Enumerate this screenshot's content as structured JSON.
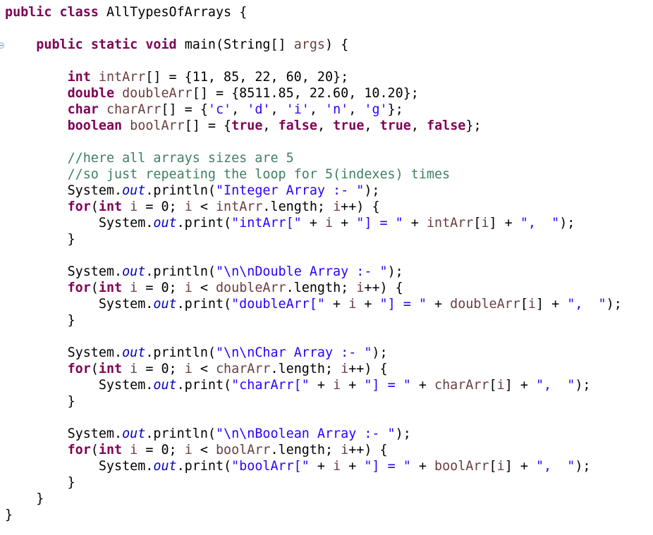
{
  "editor": {
    "lines": [
      [
        {
          "t": "public",
          "c": "kw"
        },
        {
          "t": " "
        },
        {
          "t": "class",
          "c": "kw"
        },
        {
          "t": " AllTypesOfArrays {"
        }
      ],
      [
        {
          "t": ""
        }
      ],
      [
        {
          "t": "    "
        },
        {
          "t": "public",
          "c": "kw"
        },
        {
          "t": " "
        },
        {
          "t": "static",
          "c": "kw"
        },
        {
          "t": " "
        },
        {
          "t": "void",
          "c": "kw"
        },
        {
          "t": " main(String[] "
        },
        {
          "t": "args",
          "c": "var"
        },
        {
          "t": ") {"
        }
      ],
      [
        {
          "t": ""
        }
      ],
      [
        {
          "t": "        "
        },
        {
          "t": "int",
          "c": "kw"
        },
        {
          "t": " "
        },
        {
          "t": "intArr",
          "c": "var"
        },
        {
          "t": "[] = {11, 85, 22, 60, 20};"
        }
      ],
      [
        {
          "t": "        "
        },
        {
          "t": "double",
          "c": "kw"
        },
        {
          "t": " "
        },
        {
          "t": "doubleArr",
          "c": "var"
        },
        {
          "t": "[] = {8511.85, 22.60, 10.20};"
        }
      ],
      [
        {
          "t": "        "
        },
        {
          "t": "char",
          "c": "kw"
        },
        {
          "t": " "
        },
        {
          "t": "charArr",
          "c": "var"
        },
        {
          "t": "[] = {"
        },
        {
          "t": "'c'",
          "c": "str"
        },
        {
          "t": ", "
        },
        {
          "t": "'d'",
          "c": "str"
        },
        {
          "t": ", "
        },
        {
          "t": "'i'",
          "c": "str"
        },
        {
          "t": ", "
        },
        {
          "t": "'n'",
          "c": "str"
        },
        {
          "t": ", "
        },
        {
          "t": "'g'",
          "c": "str"
        },
        {
          "t": "};"
        }
      ],
      [
        {
          "t": "        "
        },
        {
          "t": "boolean",
          "c": "kw"
        },
        {
          "t": " "
        },
        {
          "t": "boolArr",
          "c": "var"
        },
        {
          "t": "[] = {"
        },
        {
          "t": "true",
          "c": "kw"
        },
        {
          "t": ", "
        },
        {
          "t": "false",
          "c": "kw"
        },
        {
          "t": ", "
        },
        {
          "t": "true",
          "c": "kw"
        },
        {
          "t": ", "
        },
        {
          "t": "true",
          "c": "kw"
        },
        {
          "t": ", "
        },
        {
          "t": "false",
          "c": "kw"
        },
        {
          "t": "};"
        }
      ],
      [
        {
          "t": ""
        }
      ],
      [
        {
          "t": "        "
        },
        {
          "t": "//here all arrays sizes are 5",
          "c": "cmt"
        }
      ],
      [
        {
          "t": "        "
        },
        {
          "t": "//so just repeating the loop for 5(indexes) times",
          "c": "cmt"
        }
      ],
      [
        {
          "t": "        System."
        },
        {
          "t": "out",
          "c": "fld"
        },
        {
          "t": ".println("
        },
        {
          "t": "\"Integer Array :- \"",
          "c": "str"
        },
        {
          "t": ");"
        }
      ],
      [
        {
          "t": "        "
        },
        {
          "t": "for",
          "c": "kw"
        },
        {
          "t": "("
        },
        {
          "t": "int",
          "c": "kw"
        },
        {
          "t": " "
        },
        {
          "t": "i",
          "c": "var"
        },
        {
          "t": " = 0; "
        },
        {
          "t": "i",
          "c": "var"
        },
        {
          "t": " < "
        },
        {
          "t": "intArr",
          "c": "var"
        },
        {
          "t": ".length; "
        },
        {
          "t": "i",
          "c": "var"
        },
        {
          "t": "++) {"
        }
      ],
      [
        {
          "t": "            System."
        },
        {
          "t": "out",
          "c": "fld"
        },
        {
          "t": ".print("
        },
        {
          "t": "\"intArr[\"",
          "c": "str"
        },
        {
          "t": " + "
        },
        {
          "t": "i",
          "c": "var"
        },
        {
          "t": " + "
        },
        {
          "t": "\"] = \"",
          "c": "str"
        },
        {
          "t": " + "
        },
        {
          "t": "intArr",
          "c": "var"
        },
        {
          "t": "["
        },
        {
          "t": "i",
          "c": "var"
        },
        {
          "t": "] + "
        },
        {
          "t": "\",  \"",
          "c": "str"
        },
        {
          "t": ");"
        }
      ],
      [
        {
          "t": "        }"
        }
      ],
      [
        {
          "t": ""
        }
      ],
      [
        {
          "t": "        System."
        },
        {
          "t": "out",
          "c": "fld"
        },
        {
          "t": ".println("
        },
        {
          "t": "\"\\n\\nDouble Array :- \"",
          "c": "str"
        },
        {
          "t": ");"
        }
      ],
      [
        {
          "t": "        "
        },
        {
          "t": "for",
          "c": "kw"
        },
        {
          "t": "("
        },
        {
          "t": "int",
          "c": "kw"
        },
        {
          "t": " "
        },
        {
          "t": "i",
          "c": "var"
        },
        {
          "t": " = 0; "
        },
        {
          "t": "i",
          "c": "var"
        },
        {
          "t": " < "
        },
        {
          "t": "doubleArr",
          "c": "var"
        },
        {
          "t": ".length; "
        },
        {
          "t": "i",
          "c": "var"
        },
        {
          "t": "++) {"
        }
      ],
      [
        {
          "t": "            System."
        },
        {
          "t": "out",
          "c": "fld"
        },
        {
          "t": ".print("
        },
        {
          "t": "\"doubleArr[\"",
          "c": "str"
        },
        {
          "t": " + "
        },
        {
          "t": "i",
          "c": "var"
        },
        {
          "t": " + "
        },
        {
          "t": "\"] = \"",
          "c": "str"
        },
        {
          "t": " + "
        },
        {
          "t": "doubleArr",
          "c": "var"
        },
        {
          "t": "["
        },
        {
          "t": "i",
          "c": "var"
        },
        {
          "t": "] + "
        },
        {
          "t": "\",  \"",
          "c": "str"
        },
        {
          "t": ");"
        }
      ],
      [
        {
          "t": "        }"
        }
      ],
      [
        {
          "t": ""
        }
      ],
      [
        {
          "t": "        System."
        },
        {
          "t": "out",
          "c": "fld"
        },
        {
          "t": ".println("
        },
        {
          "t": "\"\\n\\nChar Array :- \"",
          "c": "str"
        },
        {
          "t": ");"
        }
      ],
      [
        {
          "t": "        "
        },
        {
          "t": "for",
          "c": "kw"
        },
        {
          "t": "("
        },
        {
          "t": "int",
          "c": "kw"
        },
        {
          "t": " "
        },
        {
          "t": "i",
          "c": "var"
        },
        {
          "t": " = 0; "
        },
        {
          "t": "i",
          "c": "var"
        },
        {
          "t": " < "
        },
        {
          "t": "charArr",
          "c": "var"
        },
        {
          "t": ".length; "
        },
        {
          "t": "i",
          "c": "var"
        },
        {
          "t": "++) {"
        }
      ],
      [
        {
          "t": "            System."
        },
        {
          "t": "out",
          "c": "fld"
        },
        {
          "t": ".print("
        },
        {
          "t": "\"charArr[\"",
          "c": "str"
        },
        {
          "t": " + "
        },
        {
          "t": "i",
          "c": "var"
        },
        {
          "t": " + "
        },
        {
          "t": "\"] = \"",
          "c": "str"
        },
        {
          "t": " + "
        },
        {
          "t": "charArr",
          "c": "var"
        },
        {
          "t": "["
        },
        {
          "t": "i",
          "c": "var"
        },
        {
          "t": "] + "
        },
        {
          "t": "\",  \"",
          "c": "str"
        },
        {
          "t": ");"
        }
      ],
      [
        {
          "t": "        }"
        }
      ],
      [
        {
          "t": ""
        }
      ],
      [
        {
          "t": "        System."
        },
        {
          "t": "out",
          "c": "fld"
        },
        {
          "t": ".println("
        },
        {
          "t": "\"\\n\\nBoolean Array :- \"",
          "c": "str"
        },
        {
          "t": ");"
        }
      ],
      [
        {
          "t": "        "
        },
        {
          "t": "for",
          "c": "kw"
        },
        {
          "t": "("
        },
        {
          "t": "int",
          "c": "kw"
        },
        {
          "t": " "
        },
        {
          "t": "i",
          "c": "var"
        },
        {
          "t": " = 0; "
        },
        {
          "t": "i",
          "c": "var"
        },
        {
          "t": " < "
        },
        {
          "t": "boolArr",
          "c": "var"
        },
        {
          "t": ".length; "
        },
        {
          "t": "i",
          "c": "var"
        },
        {
          "t": "++) {"
        }
      ],
      [
        {
          "t": "            System."
        },
        {
          "t": "out",
          "c": "fld"
        },
        {
          "t": ".print("
        },
        {
          "t": "\"boolArr[\"",
          "c": "str"
        },
        {
          "t": " + "
        },
        {
          "t": "i",
          "c": "var"
        },
        {
          "t": " + "
        },
        {
          "t": "\"] = \"",
          "c": "str"
        },
        {
          "t": " + "
        },
        {
          "t": "boolArr",
          "c": "var"
        },
        {
          "t": "["
        },
        {
          "t": "i",
          "c": "var"
        },
        {
          "t": "] + "
        },
        {
          "t": "\",  \"",
          "c": "str"
        },
        {
          "t": ");"
        }
      ],
      [
        {
          "t": "        }"
        }
      ],
      [
        {
          "t": "    }"
        }
      ],
      [
        {
          "t": "}"
        }
      ]
    ]
  },
  "colors": {
    "keyword": "#7f0055",
    "string": "#2a00ff",
    "comment": "#3f7f5f",
    "static_field": "#0000c0",
    "local_variable": "#6a3e3e",
    "plain": "#000000",
    "background": "#ffffff"
  },
  "icons": {
    "fold_marker": "fold-collapse-icon"
  }
}
